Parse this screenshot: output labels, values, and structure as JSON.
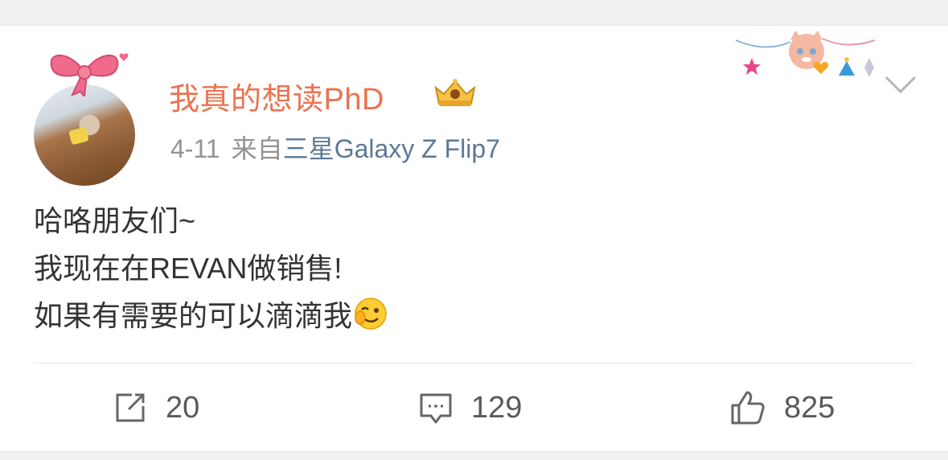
{
  "post": {
    "username": "我真的想读PhD",
    "time": "4-11",
    "source_prefix": "来自",
    "device": "三星Galaxy Z Flip7",
    "lines": [
      "哈咯朋友们~",
      "我现在在REVAN做销售!",
      "如果有需要的可以滴滴我"
    ]
  },
  "actions": {
    "repost_count": "20",
    "comment_count": "129",
    "like_count": "825"
  },
  "colors": {
    "username": "#eb7350",
    "device_link": "#5d7896",
    "text": "#333333",
    "meta": "#939393"
  },
  "icons": {
    "bow": "pink-bow-icon",
    "crown": "vip-crown-icon",
    "decor": "party-bunting-icon",
    "chevron": "chevron-down-icon",
    "emoji": "wink-face-icon",
    "repost": "repost-icon",
    "comment": "comment-icon",
    "like": "thumbs-up-icon"
  }
}
